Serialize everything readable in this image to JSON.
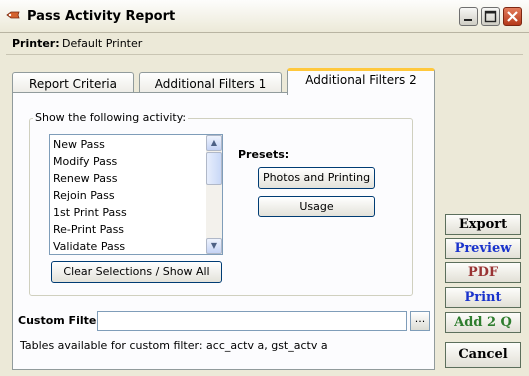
{
  "window": {
    "title": "Pass Activity Report"
  },
  "printer": {
    "label": "Printer:",
    "value": "Default Printer"
  },
  "tabs": [
    {
      "label": "Report Criteria"
    },
    {
      "label": "Additional Filters 1"
    },
    {
      "label": "Additional Filters 2"
    }
  ],
  "activity": {
    "group_title": "Show the following activity:",
    "items": [
      "New Pass",
      "Modify Pass",
      "Renew Pass",
      "Rejoin Pass",
      "1st Print Pass",
      "Re-Print Pass",
      "Validate Pass"
    ],
    "clear_label": "Clear Selections / Show All"
  },
  "presets": {
    "label": "Presets:",
    "buttons": [
      {
        "label": "Photos and Printing"
      },
      {
        "label": "Usage"
      }
    ]
  },
  "custom_filter": {
    "label": "Custom Filter",
    "value": "",
    "browse_label": "...",
    "tables_note": "Tables available for custom filter: acc_actv a, gst_actv a"
  },
  "side_buttons": [
    {
      "label": "Export",
      "color": "#000000"
    },
    {
      "label": "Preview",
      "color": "#1a33cc"
    },
    {
      "label": "PDF",
      "color": "#993333"
    },
    {
      "label": "Print",
      "color": "#1a33cc"
    },
    {
      "label": "Add 2 Q",
      "color": "#2e7d2e"
    },
    {
      "label": "Cancel",
      "color": "#000000"
    }
  ],
  "icons": {
    "app": "key-icon",
    "minimize": "minimize-icon",
    "maximize": "maximize-icon",
    "close": "close-icon"
  }
}
